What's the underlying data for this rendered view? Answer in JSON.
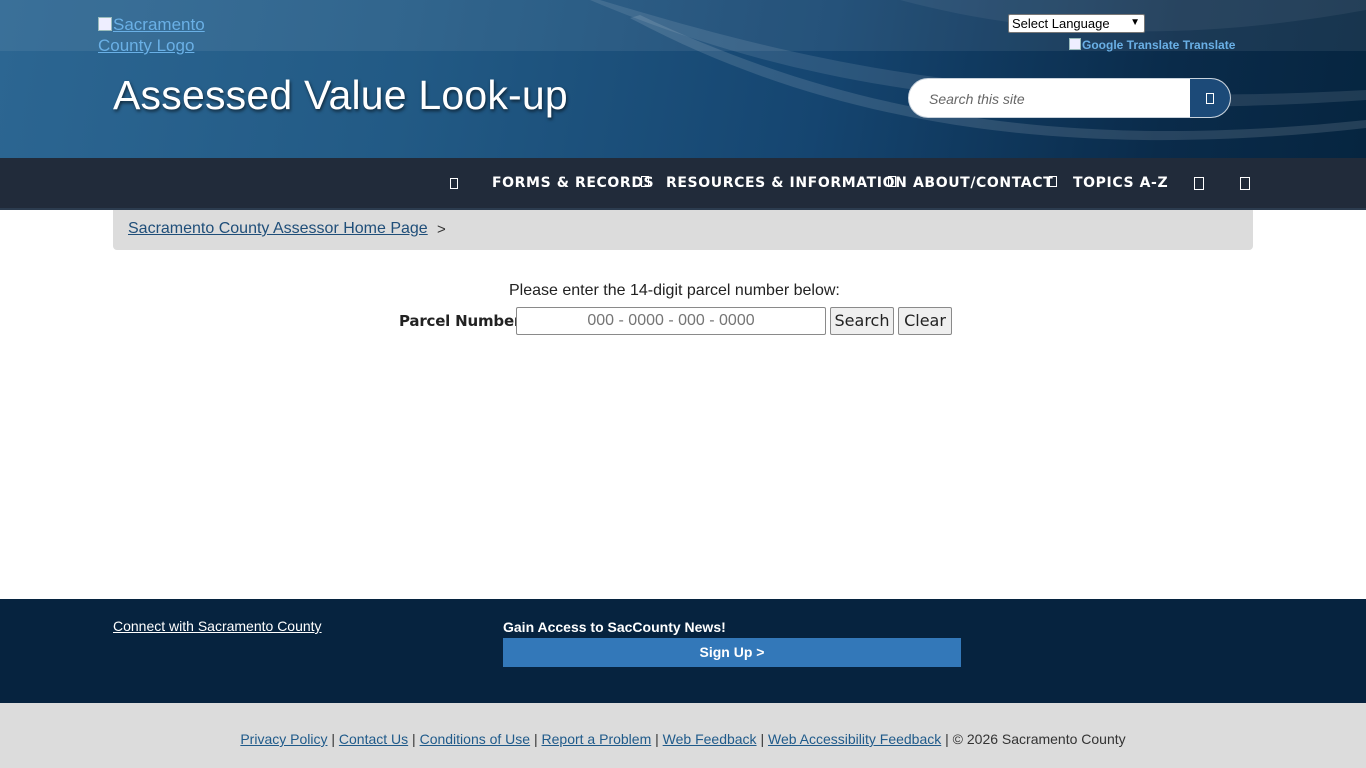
{
  "header": {
    "logo_alt": "Sacramento County Logo",
    "title": "Assessed Value Look-up",
    "language_select": "Select Language",
    "google_translate_alt": "Google Translate",
    "translate_label": "Translate",
    "search_placeholder": "Search this site"
  },
  "nav": {
    "items": [
      "FORMS & RECORDS",
      "RESOURCES & INFORMATION",
      "ABOUT/CONTACT",
      "TOPICS A-Z"
    ]
  },
  "breadcrumb": {
    "link": "Sacramento County Assessor Home Page",
    "separator": ">"
  },
  "form": {
    "prompt": "Please enter the 14-digit parcel number below:",
    "label": "Parcel Number:",
    "placeholder": "000 - 0000 - 000 - 0000",
    "search_button": "Search",
    "clear_button": "Clear"
  },
  "footer": {
    "connect": "Connect with Sacramento County",
    "news_heading": "Gain Access to SacCounty News!",
    "signup": "Sign Up >"
  },
  "bottom": {
    "links": [
      "Privacy Policy",
      "Contact Us",
      "Conditions of Use",
      "Report a Problem",
      "Web Feedback",
      "Web Accessibility Feedback"
    ],
    "separator": "|",
    "copyright": "© 2026 Sacramento County"
  },
  "colors": {
    "header_dark": "#062540",
    "nav_bg": "#212b3a",
    "footer_bg": "#06233f",
    "signup_bg": "#3378b9",
    "link": "#1f4e79"
  }
}
